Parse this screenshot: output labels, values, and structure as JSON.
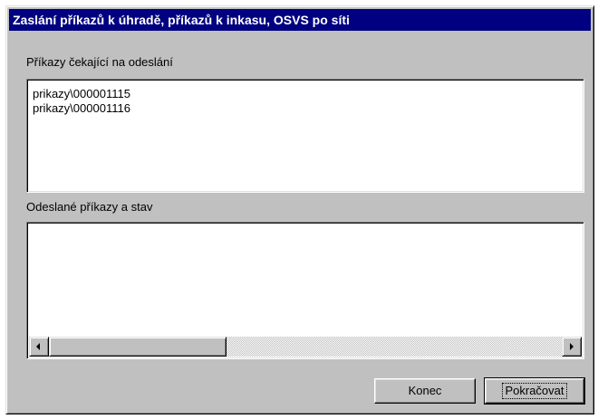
{
  "dialog": {
    "title": "Zaslání příkazů k úhradě, příkazů k inkasu, OSVS po síti"
  },
  "pending": {
    "label": "Příkazy čekající na odeslání",
    "items": [
      "prikazy\\000001115",
      "prikazy\\000001116"
    ]
  },
  "sent": {
    "label": "Odeslané příkazy a stav"
  },
  "buttons": {
    "konec": "Konec",
    "pokracovat": "Pokračovat"
  }
}
